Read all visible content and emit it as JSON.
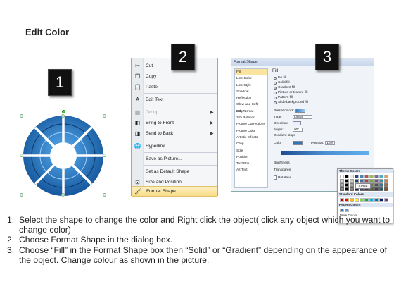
{
  "heading": "Edit Color",
  "step_badges": [
    "1",
    "2",
    "3"
  ],
  "context_menu": {
    "items": [
      {
        "label": "Cut",
        "icon": "scissors-icon",
        "enabled": true,
        "submenu": false
      },
      {
        "label": "Copy",
        "icon": "copy-icon",
        "enabled": true,
        "submenu": false
      },
      {
        "label": "Paste",
        "icon": "paste-icon",
        "enabled": true,
        "submenu": false
      },
      {
        "label": "Edit Text",
        "icon": "edit-text-icon",
        "enabled": true,
        "submenu": false
      },
      {
        "label": "Group",
        "icon": "group-icon",
        "enabled": false,
        "submenu": true
      },
      {
        "label": "Bring to Front",
        "icon": "bring-front-icon",
        "enabled": true,
        "submenu": true
      },
      {
        "label": "Send to Back",
        "icon": "send-back-icon",
        "enabled": true,
        "submenu": true
      },
      {
        "label": "Hyperlink...",
        "icon": "hyperlink-icon",
        "enabled": true,
        "submenu": false
      },
      {
        "label": "Save as Picture...",
        "icon": "",
        "enabled": true,
        "submenu": false
      },
      {
        "label": "Set as Default Shape",
        "icon": "",
        "enabled": true,
        "submenu": false
      },
      {
        "label": "Size and Position...",
        "icon": "size-position-icon",
        "enabled": true,
        "submenu": false
      },
      {
        "label": "Format Shape...",
        "icon": "format-shape-icon",
        "enabled": true,
        "submenu": false,
        "highlighted": true
      }
    ]
  },
  "dialog": {
    "title": "Format Shape",
    "sidebar": [
      "Fill",
      "Line Color",
      "Line Style",
      "Shadow",
      "Reflection",
      "Glow and Soft Edges",
      "3-D Format",
      "3-D Rotation",
      "Picture Corrections",
      "Picture Color",
      "Artistic Effects",
      "Crop",
      "Size",
      "Position",
      "Text Box",
      "Alt Text"
    ],
    "section_title": "Fill",
    "fill_options": [
      {
        "label": "No fill",
        "selected": false
      },
      {
        "label": "Solid fill",
        "selected": false
      },
      {
        "label": "Gradient fill",
        "selected": true
      },
      {
        "label": "Picture or texture fill",
        "selected": false
      },
      {
        "label": "Pattern fill",
        "selected": false
      },
      {
        "label": "Slide background fill",
        "selected": false
      }
    ],
    "preset_colors_label": "Preset colors:",
    "type_label": "Type:",
    "type_value": "Linear",
    "direction_label": "Direction:",
    "angle_label": "Angle:",
    "angle_value": "90°",
    "gradient_stops_label": "Gradient stops",
    "color_label": "Color",
    "position_label": "Position:",
    "position_value": "16%",
    "brightness_label": "Brightness",
    "transparency_label": "Transparen",
    "rotate_label": "Rotate w",
    "close_label": "Close",
    "palette": {
      "theme_label": "Theme Colors",
      "standard_label": "Standard Colors",
      "recent_label": "Recent Colors",
      "more_label": "More Colors...",
      "theme_top": [
        "#ffffff",
        "#000000",
        "#eeece1",
        "#1f497d",
        "#4f81bd",
        "#c0504d",
        "#9bbb59",
        "#8064a2",
        "#4bacc6",
        "#f79646"
      ],
      "standard": [
        "#c00000",
        "#ff0000",
        "#ffc000",
        "#ffff00",
        "#92d050",
        "#00b050",
        "#00b0f0",
        "#0070c0",
        "#002060",
        "#7030a0"
      ],
      "recent": [
        "#2e75b6",
        "#5b9bd5"
      ]
    }
  },
  "instructions": [
    {
      "num": "1.",
      "text": "Select the shape to change the color and Right click the object( click any object which you want to change color)"
    },
    {
      "num": "2.",
      "text": "Choose Format Shape in the dialog box."
    },
    {
      "num": "3.",
      "text": "Choose “Fill” in the Format Shape box then “Solid” or “Gradient” depending on the appearance of the object. Change colour as shown in the picture."
    }
  ],
  "colors": {
    "shape_primary": "#1f6fc0",
    "shape_dark": "#13497f",
    "shape_light": "#3d93e0",
    "badge_bg": "#111111",
    "menu_highlight": "#f8dd86"
  }
}
